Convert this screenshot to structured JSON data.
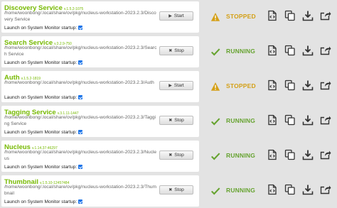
{
  "launch_label": "Launch on System Monitor startup:",
  "start_label": "Start",
  "stop_label": "Stop",
  "status_labels": {
    "stopped": "STOPPED",
    "running": "RUNNING"
  },
  "colors": {
    "accent": "#76b900",
    "stopped": "#d4a017",
    "running": "#66a330",
    "background": "#e3e3e3"
  },
  "services": [
    {
      "name": "Discovery Service",
      "version": "v.1.5.2-1075",
      "path": "/home/woonbong/.local/share/ov/pkg/nucleus-workstation-2023.2.3/Discovery Service",
      "launch_on_startup": true,
      "status": "stopped",
      "action": "start"
    },
    {
      "name": "Search Service",
      "version": "v.3.2.9-750",
      "path": "/home/woonbong/.local/share/ov/pkg/nucleus-workstation-2023.2.3/Search Service",
      "launch_on_startup": true,
      "status": "running",
      "action": "stop"
    },
    {
      "name": "Auth",
      "version": "v.1.5.2-1819",
      "path": "/home/woonbong/.local/share/ov/pkg/nucleus-workstation-2023.2.3/Auth",
      "launch_on_startup": true,
      "status": "stopped",
      "action": "start"
    },
    {
      "name": "Tagging Service",
      "version": "v.3.1.11-1447",
      "path": "/home/woonbong/.local/share/ov/pkg/nucleus-workstation-2023.2.3/Tagging Service",
      "launch_on_startup": true,
      "status": "running",
      "action": "stop"
    },
    {
      "name": "Nucleus",
      "version": "v.1.14.37-46297",
      "path": "/home/woonbong/.local/share/ov/pkg/nucleus-workstation-2023.2.3/Nucleus",
      "launch_on_startup": true,
      "status": "running",
      "action": "stop"
    },
    {
      "name": "Thumbnail",
      "version": "v.1.5.10-12457484",
      "path": "/home/woonbong/.local/share/ov/pkg/nucleus-workstation-2023.2.3/Thumbnail",
      "launch_on_startup": true,
      "status": "running",
      "action": "stop"
    }
  ],
  "action_icons": [
    "settings-doc-icon",
    "copy-icon",
    "download-icon",
    "share-icon"
  ]
}
